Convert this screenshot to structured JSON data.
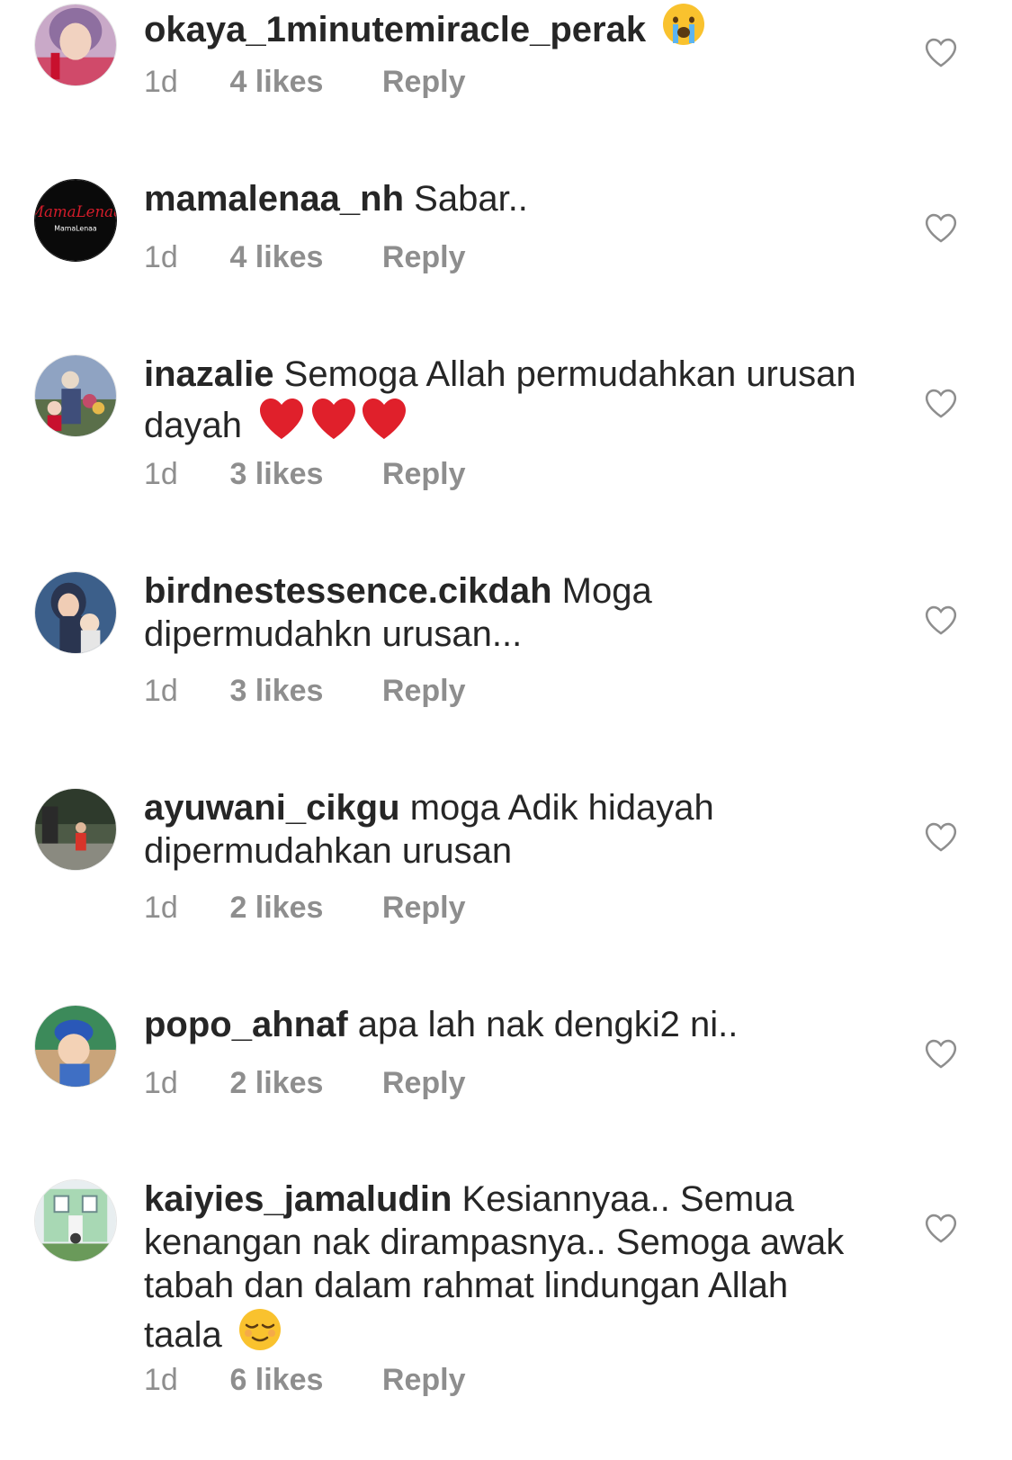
{
  "comments": [
    {
      "username": "okaya_1minutemiracle_perak",
      "text": "",
      "emoji": "crying-face",
      "age": "1d",
      "likes": "4 likes",
      "reply": "Reply"
    },
    {
      "username": "mamalenaa_nh",
      "text": "Sabar..",
      "age": "1d",
      "likes": "4 likes",
      "reply": "Reply",
      "avatar_logo": "MamaLenaa",
      "avatar_logo_sub": "MamaLenaa"
    },
    {
      "username": "inazalie",
      "text": "Semoga Allah permudahkan urusan dayah",
      "emoji": "red-hearts",
      "age": "1d",
      "likes": "3 likes",
      "reply": "Reply"
    },
    {
      "username": "birdnestessence.cikdah",
      "text": "Moga dipermudahkn urusan...",
      "age": "1d",
      "likes": "3 likes",
      "reply": "Reply"
    },
    {
      "username": "ayuwani_cikgu",
      "text": "moga Adik hidayah dipermudahkan urusan",
      "age": "1d",
      "likes": "2 likes",
      "reply": "Reply"
    },
    {
      "username": "popo_ahnaf",
      "text": "apa lah nak dengki2 ni..",
      "age": "1d",
      "likes": "2 likes",
      "reply": "Reply"
    },
    {
      "username": "kaiyies_jamaludin",
      "text": "Kesiannyaa.. Semua kenangan nak dirampasnya.. Semoga awak tabah dan dalam rahmat lindungan Allah taala",
      "emoji": "relieved-face",
      "age": "1d",
      "likes": "6 likes",
      "reply": "Reply"
    }
  ],
  "colors": {
    "text": "#262626",
    "meta": "#8e8e8e",
    "heart_outline": "#8e8e8e",
    "red_heart": "#e0202b",
    "emoji_yellow": "#f9c22e"
  }
}
